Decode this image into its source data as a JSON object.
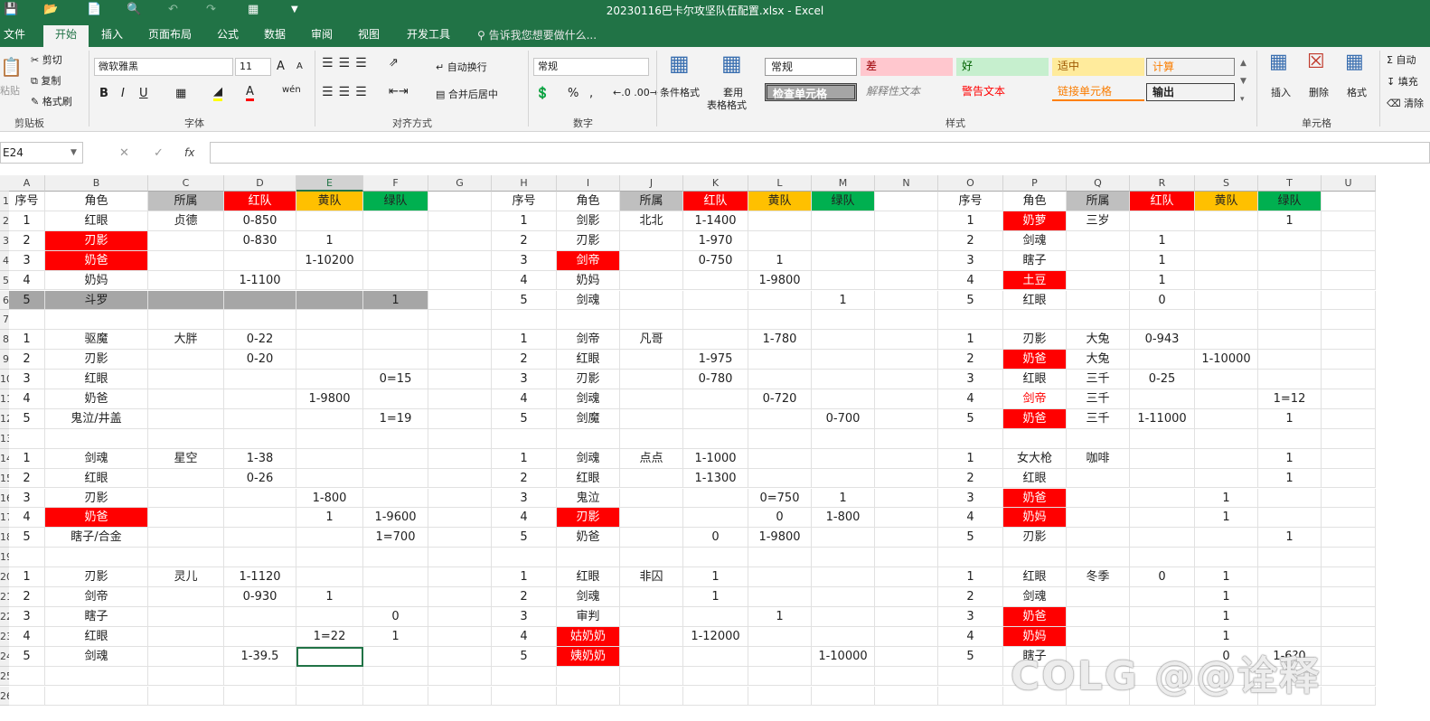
{
  "titlebar": {
    "title": "20230116巴卡尔攻坚队伍配置.xlsx  -  Excel",
    "quick_access": [
      "save-icon",
      "open-icon",
      "new-icon",
      "print-preview-icon",
      "undo-icon",
      "redo-icon",
      "form-icon",
      "customize-icon"
    ]
  },
  "tabs": [
    "文件",
    "开始",
    "插入",
    "页面布局",
    "公式",
    "数据",
    "审阅",
    "视图",
    "开发工具"
  ],
  "tell_me": "告诉我您想要做什么...",
  "ribbon": {
    "clipboard": {
      "paste": "粘贴",
      "cut": "剪切",
      "copy": "复制",
      "format_painter": "格式刷",
      "label": "剪贴板"
    },
    "font": {
      "name": "微软雅黑",
      "size": "11",
      "label": "字体",
      "bold": "B",
      "italic": "I",
      "underline": "U",
      "grow": "A",
      "shrink": "A",
      "wen": "wén"
    },
    "alignment": {
      "wrap": "自动换行",
      "merge": "合并后居中",
      "label": "对齐方式"
    },
    "number": {
      "format": "常规",
      "percent": "%",
      "comma": ",",
      "label": "数字"
    },
    "styles": {
      "cond": "条件格式",
      "table1": "套用",
      "table2": "表格格式",
      "label": "样式",
      "items": [
        {
          "text": "常规"
        },
        {
          "text": "差"
        },
        {
          "text": "好"
        },
        {
          "text": "适中"
        },
        {
          "text": "计算"
        },
        {
          "text": "检查单元格"
        },
        {
          "text": "解释性文本"
        },
        {
          "text": "警告文本"
        },
        {
          "text": "链接单元格"
        },
        {
          "text": "输出"
        }
      ]
    },
    "cells": {
      "insert": "插入",
      "delete": "删除",
      "format": "格式",
      "label": "单元格"
    },
    "editing": {
      "autosum": "自动",
      "fill": "填充",
      "clear": "清除"
    }
  },
  "formula_bar": {
    "name_box": "E24",
    "fx": "fx",
    "cancel": "✕",
    "enter": "✓",
    "value": ""
  },
  "columns": [
    "A",
    "B",
    "C",
    "D",
    "E",
    "F",
    "G",
    "H",
    "I",
    "J",
    "K",
    "L",
    "M",
    "N",
    "O",
    "P",
    "Q",
    "R",
    "S",
    "T",
    "U"
  ],
  "rows": [
    "1",
    "2",
    "3",
    "4",
    "5",
    "6",
    "7",
    "8",
    "9",
    "10",
    "11",
    "12",
    "13",
    "14",
    "15",
    "16",
    "17",
    "18",
    "19",
    "20",
    "21",
    "22",
    "23",
    "24",
    "25",
    "26"
  ],
  "cells": [
    [
      "序号",
      "角色",
      "所属",
      "红队",
      "黄队",
      "绿队",
      "",
      "序号",
      "角色",
      "所属",
      "红队",
      "黄队",
      "绿队",
      "",
      "序号",
      "角色",
      "所属",
      "红队",
      "黄队",
      "绿队",
      ""
    ],
    [
      "1",
      "红眼",
      "贞德",
      "0-850",
      "",
      "",
      "",
      "1",
      "剑影",
      "北北",
      "1-1400",
      "",
      "",
      "",
      "1",
      "奶萝",
      "三岁",
      "",
      "",
      "1",
      ""
    ],
    [
      "2",
      "刃影",
      "",
      "0-830",
      "1",
      "",
      "",
      "2",
      "刃影",
      "",
      "1-970",
      "",
      "",
      "",
      "2",
      "剑魂",
      "",
      "1",
      "",
      "",
      ""
    ],
    [
      "3",
      "奶爸",
      "",
      "",
      "1-10200",
      "",
      "",
      "3",
      "剑帝",
      "",
      "0-750",
      "1",
      "",
      "",
      "3",
      "瞎子",
      "",
      "1",
      "",
      "",
      ""
    ],
    [
      "4",
      "奶妈",
      "",
      "1-1100",
      "",
      "",
      "",
      "4",
      "奶妈",
      "",
      "",
      "1-9800",
      "",
      "",
      "4",
      "土豆",
      "",
      "1",
      "",
      "",
      ""
    ],
    [
      "5",
      "斗罗",
      "",
      "",
      "",
      "1",
      "",
      "5",
      "剑魂",
      "",
      "",
      "",
      "1",
      "",
      "5",
      "红眼",
      "",
      "0",
      "",
      "",
      ""
    ],
    [
      "",
      "",
      "",
      "",
      "",
      "",
      "",
      "",
      "",
      "",
      "",
      "",
      "",
      "",
      "",
      "",
      "",
      "",
      "",
      "",
      ""
    ],
    [
      "1",
      "驱魔",
      "大胖",
      "0-22",
      "",
      "",
      "",
      "1",
      "剑帝",
      "凡哥",
      "",
      "1-780",
      "",
      "",
      "1",
      "刃影",
      "大兔",
      "0-943",
      "",
      "",
      ""
    ],
    [
      "2",
      "刃影",
      "",
      "0-20",
      "",
      "",
      "",
      "2",
      "红眼",
      "",
      "1-975",
      "",
      "",
      "",
      "2",
      "奶爸",
      "大兔",
      "",
      "1-10000",
      "",
      ""
    ],
    [
      "3",
      "红眼",
      "",
      "",
      "",
      "0=15",
      "",
      "3",
      "刃影",
      "",
      "0-780",
      "",
      "",
      "",
      "3",
      "红眼",
      "三千",
      "0-25",
      "",
      "",
      ""
    ],
    [
      "4",
      "奶爸",
      "",
      "",
      "1-9800",
      "",
      "",
      "4",
      "剑魂",
      "",
      "",
      "0-720",
      "",
      "",
      "4",
      "剑帝",
      "三千",
      "",
      "",
      "1=12",
      ""
    ],
    [
      "5",
      "鬼泣/井盖",
      "",
      "",
      "",
      "1=19",
      "",
      "5",
      "剑魔",
      "",
      "",
      "",
      "0-700",
      "",
      "5",
      "奶爸",
      "三千",
      "1-11000",
      "",
      "1",
      ""
    ],
    [
      "",
      "",
      "",
      "",
      "",
      "",
      "",
      "",
      "",
      "",
      "",
      "",
      "",
      "",
      "",
      "",
      "",
      "",
      "",
      "",
      ""
    ],
    [
      "1",
      "剑魂",
      "星空",
      "1-38",
      "",
      "",
      "",
      "1",
      "剑魂",
      "点点",
      "1-1000",
      "",
      "",
      "",
      "1",
      "女大枪",
      "咖啡",
      "",
      "",
      "1",
      ""
    ],
    [
      "2",
      "红眼",
      "",
      "0-26",
      "",
      "",
      "",
      "2",
      "红眼",
      "",
      "1-1300",
      "",
      "",
      "",
      "2",
      "红眼",
      "",
      "",
      "",
      "1",
      ""
    ],
    [
      "3",
      "刃影",
      "",
      "",
      "1-800",
      "",
      "",
      "3",
      "鬼泣",
      "",
      "",
      "0=750",
      "1",
      "",
      "3",
      "奶爸",
      "",
      "",
      "1",
      "",
      ""
    ],
    [
      "4",
      "奶爸",
      "",
      "",
      "1",
      "1-9600",
      "",
      "4",
      "刃影",
      "",
      "",
      "0",
      "1-800",
      "",
      "4",
      "奶妈",
      "",
      "",
      "1",
      "",
      ""
    ],
    [
      "5",
      "瞎子/合金",
      "",
      "",
      "",
      "1=700",
      "",
      "5",
      "奶爸",
      "",
      "0",
      "1-9800",
      "",
      "",
      "5",
      "刃影",
      "",
      "",
      "",
      "1",
      ""
    ],
    [
      "",
      "",
      "",
      "",
      "",
      "",
      "",
      "",
      "",
      "",
      "",
      "",
      "",
      "",
      "",
      "",
      "",
      "",
      "",
      "",
      ""
    ],
    [
      "1",
      "刃影",
      "灵儿",
      "1-1120",
      "",
      "",
      "",
      "1",
      "红眼",
      "非囚",
      "1",
      "",
      "",
      "",
      "1",
      "红眼",
      "冬季",
      "0",
      "1",
      "",
      ""
    ],
    [
      "2",
      "剑帝",
      "",
      "0-930",
      "1",
      "",
      "",
      "2",
      "剑魂",
      "",
      "1",
      "",
      "",
      "",
      "2",
      "剑魂",
      "",
      "",
      "1",
      "",
      ""
    ],
    [
      "3",
      "瞎子",
      "",
      "",
      "",
      "0",
      "",
      "3",
      "审判",
      "",
      "",
      "1",
      "",
      "",
      "3",
      "奶爸",
      "",
      "",
      "1",
      "",
      ""
    ],
    [
      "4",
      "红眼",
      "",
      "",
      "1=22",
      "1",
      "",
      "4",
      "姑奶奶",
      "",
      "1-12000",
      "",
      "",
      "",
      "4",
      "奶妈",
      "",
      "",
      "1",
      "",
      ""
    ],
    [
      "5",
      "剑魂",
      "",
      "1-39.5",
      "",
      "",
      "",
      "5",
      "姨奶奶",
      "",
      "",
      "",
      "1-10000",
      "",
      "5",
      "瞎子",
      "",
      "",
      "0",
      "1-6?0",
      ""
    ],
    [
      "",
      "",
      "",
      "",
      "",
      "",
      "",
      "",
      "",
      "",
      "",
      "",
      "",
      "",
      "",
      "",
      "",
      "",
      "",
      "",
      ""
    ],
    [
      "",
      "",
      "",
      "",
      "",
      "",
      "",
      "",
      "",
      "",
      "",
      "",
      "",
      "",
      "",
      "",
      "",
      "",
      "",
      "",
      ""
    ]
  ],
  "watermark": "COLG @@诠释",
  "colors": {
    "excel_green": "#217346",
    "red": "#ff0000",
    "yellow": "#ffc000",
    "green": "#00b050",
    "gray": "#bfbfbf"
  }
}
